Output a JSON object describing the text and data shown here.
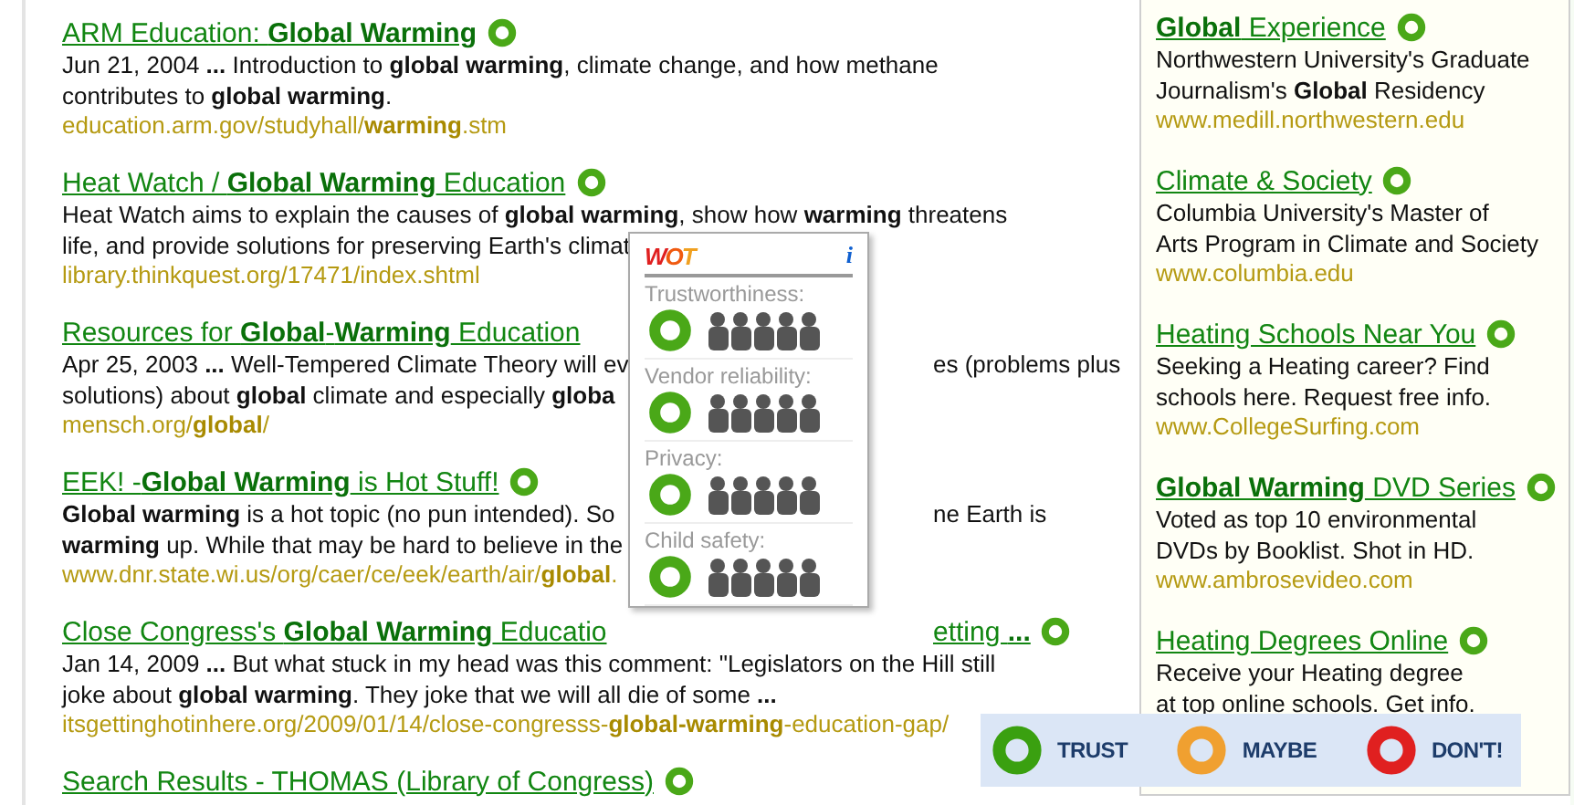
{
  "results": [
    {
      "title": "ARM Education: **Global Warming**",
      "color": "#4aa818",
      "lines": [
        {
          "left": "Jun 21, 2004 **...** Introduction to **global warming**, climate change, and how methane"
        },
        {
          "left": "contributes to **global warming**."
        }
      ],
      "url": "education.arm.gov/studyhall/**warming**.stm"
    },
    {
      "title": "Heat Watch / **Global Warming** Education",
      "color": "#4aa818",
      "lines": [
        {
          "left": "Heat Watch aims to explain the causes of **global warming**, show how **warming** threatens"
        },
        {
          "left": "life, and provide solutions for preserving Earth's climat"
        }
      ],
      "url": "library.thinkquest.org/17471/index.shtml"
    },
    {
      "title": "Resources for **Global**-**Warming** Education",
      "lines": [
        {
          "left": "Apr 25, 2003 **...** Well-Tempered Climate Theory will ev",
          "right": "es (problems plus"
        },
        {
          "left": "solutions) about **global** climate and especially **globa**"
        }
      ],
      "url": "mensch.org/**global**/"
    },
    {
      "title": "EEK! -**Global Warming** is Hot Stuff!",
      "color": "#4aa818",
      "lines": [
        {
          "left": "**Global warming** is a hot topic (no pun intended). So",
          "right": "ne Earth is"
        },
        {
          "left": "**warming** up. While that may be hard to believe in the"
        }
      ],
      "url": "www.dnr.state.wi.us/org/caer/ce/eek/earth/air/**global**."
    },
    {
      "title": "Close Congress's **Global Warming** Educatio",
      "title_right": "etting **...**",
      "color": "#4aa818",
      "lines": [
        {
          "left": "Jan 14, 2009 **...** But what stuck in my head was this comment: \"Legislators on the Hill still"
        },
        {
          "left": "joke about **global warming**. They joke that we will all die of some **...**"
        }
      ],
      "url": "itsgettinghotinhere.org/2009/01/14/close-congresss-**global-warming**-education-gap/"
    },
    {
      "title": "Search Results - THOMAS (Library of Congress)",
      "color": "#4aa818"
    }
  ],
  "ads": [
    {
      "title": "**Global** Experience",
      "lines": [
        "Northwestern University's Graduate",
        "Journalism's **Global** Residency"
      ],
      "url": "www.medill.northwestern.edu"
    },
    {
      "title": "Climate & Society",
      "lines": [
        "Columbia University's Master of",
        "Arts Program in Climate and Society"
      ],
      "url": "www.columbia.edu"
    },
    {
      "title": "Heating Schools Near You",
      "lines": [
        "Seeking a Heating career? Find",
        "schools here. Request free info."
      ],
      "url": "www.CollegeSurfing.com"
    },
    {
      "title": "**Global Warming** DVD Series",
      "lines": [
        "Voted as top 10 environmental",
        "DVDs by Booklist. Shot in HD."
      ],
      "url": "www.ambrosevideo.com"
    },
    {
      "title": "Heating Degrees Online",
      "lines": [
        "Receive your Heating degree",
        "at top online schools. Get info."
      ]
    }
  ],
  "popup": {
    "logo": [
      {
        "text": "W",
        "color": "#e02020"
      },
      {
        "text": "O",
        "color": "#f05a10"
      },
      {
        "text": "T",
        "color": "#f0a020"
      }
    ],
    "info": "i",
    "categories": [
      {
        "label": "Trustworthiness:"
      },
      {
        "label": "Vendor reliability:"
      },
      {
        "label": "Privacy:"
      },
      {
        "label": "Child safety:"
      }
    ]
  },
  "legend": [
    {
      "label": "TRUST",
      "color": "#3aa010"
    },
    {
      "label": "MAYBE",
      "color": "#f0a030"
    },
    {
      "label": "DON'T!",
      "color": "#e02020"
    }
  ]
}
